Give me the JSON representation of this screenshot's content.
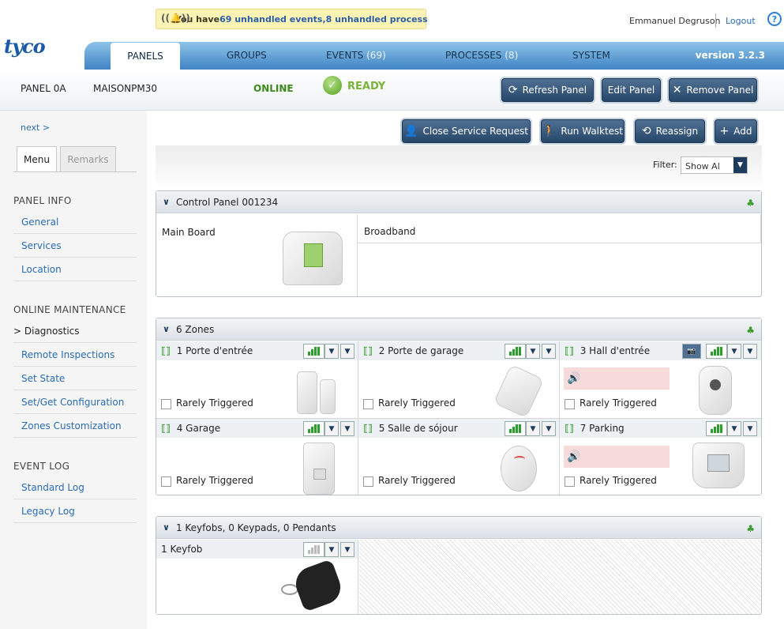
{
  "notification": {
    "prefix": "You have ",
    "events": "69 unhandled events",
    "sep": " , ",
    "processes": "8 unhandled process"
  },
  "user": {
    "name": "Emmanuel Degruson",
    "logout": "Logout",
    "help": "?"
  },
  "brand": {
    "logo": "tyco"
  },
  "nav": {
    "tabs": [
      {
        "label": "PANELS",
        "count": ""
      },
      {
        "label": "GROUPS",
        "count": ""
      },
      {
        "label": "EVENTS",
        "count": "(69)"
      },
      {
        "label": "PROCESSES",
        "count": "(8)"
      },
      {
        "label": "SYSTEM",
        "count": ""
      }
    ],
    "version": "version 3.2.3"
  },
  "panel": {
    "id": "PANEL 0A",
    "name": "MAISONPM30",
    "status": "ONLINE",
    "state": "READY"
  },
  "actions": {
    "refresh": "Refresh Panel",
    "edit": "Edit Panel",
    "remove": "Remove Panel"
  },
  "commands": {
    "close_service": "Close Service Request",
    "walktest": "Run Walktest",
    "reassign": "Reassign",
    "add": "Add"
  },
  "filter": {
    "label": "Filter:",
    "value": "Show Al"
  },
  "sidebar": {
    "next": "next >",
    "tabs": [
      "Menu",
      "Remarks"
    ],
    "sections": [
      {
        "title": "PANEL INFO",
        "items": [
          "General",
          "Services",
          "Location"
        ]
      },
      {
        "title": "ONLINE MAINTENANCE",
        "items": [
          "> Diagnostics",
          "Remote Inspections",
          "Set State",
          "Set/Get Configuration",
          "Zones Customization"
        ]
      },
      {
        "title": "EVENT LOG",
        "items": [
          "Standard Log",
          "Legacy Log"
        ]
      }
    ]
  },
  "control_panel": {
    "title": "Control Panel 001234",
    "main_board": "Main Board",
    "broadband": "Broadband"
  },
  "zones": {
    "title": "6 Zones",
    "items": [
      {
        "num": "1",
        "name": "Porte d'entrée",
        "status": "Rarely Triggered"
      },
      {
        "num": "2",
        "name": "Porte de garage",
        "status": "Rarely Triggered"
      },
      {
        "num": "3",
        "name": "Hall d'entrée",
        "status": "Rarely Triggered"
      },
      {
        "num": "4",
        "name": "Garage",
        "status": "Rarely Triggered"
      },
      {
        "num": "5",
        "name": "Salle de sójour",
        "status": "Rarely Triggered"
      },
      {
        "num": "7",
        "name": "Parking",
        "status": "Rarely Triggered"
      }
    ]
  },
  "keyfobs": {
    "title": "1 Keyfobs, 0 Keypads, 0 Pendants",
    "items": [
      {
        "num": "1",
        "name": "Keyfob"
      }
    ]
  },
  "colors": {
    "nav_blue": "#3f84c4",
    "button": "#274769",
    "online": "#3b8a1c",
    "signal": "#2aa02a",
    "alarm": "#f7dada"
  }
}
